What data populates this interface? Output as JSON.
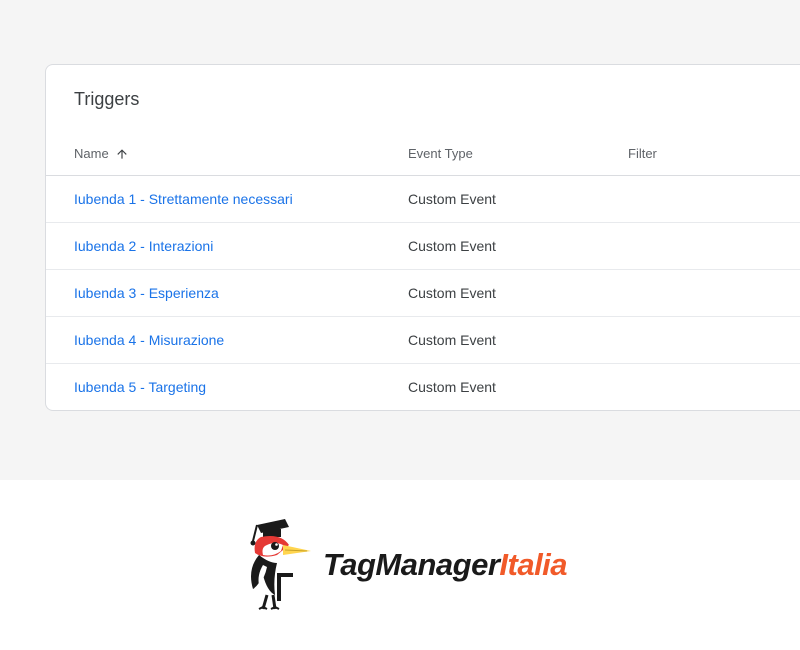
{
  "panel": {
    "title": "Triggers"
  },
  "columns": {
    "name": "Name",
    "event_type": "Event Type",
    "filter": "Filter"
  },
  "triggers": [
    {
      "name": "Iubenda 1 - Strettamente necessari",
      "event_type": "Custom Event",
      "filter": ""
    },
    {
      "name": "Iubenda 2 - Interazioni",
      "event_type": "Custom Event",
      "filter": ""
    },
    {
      "name": "Iubenda 3 - Esperienza",
      "event_type": "Custom Event",
      "filter": ""
    },
    {
      "name": "Iubenda 4 - Misurazione",
      "event_type": "Custom Event",
      "filter": ""
    },
    {
      "name": "Iubenda 5 - Targeting",
      "event_type": "Custom Event",
      "filter": ""
    }
  ],
  "logo": {
    "part1": "TagManager",
    "part2": "Italia",
    "icon": "woodpecker-graduate-icon"
  }
}
